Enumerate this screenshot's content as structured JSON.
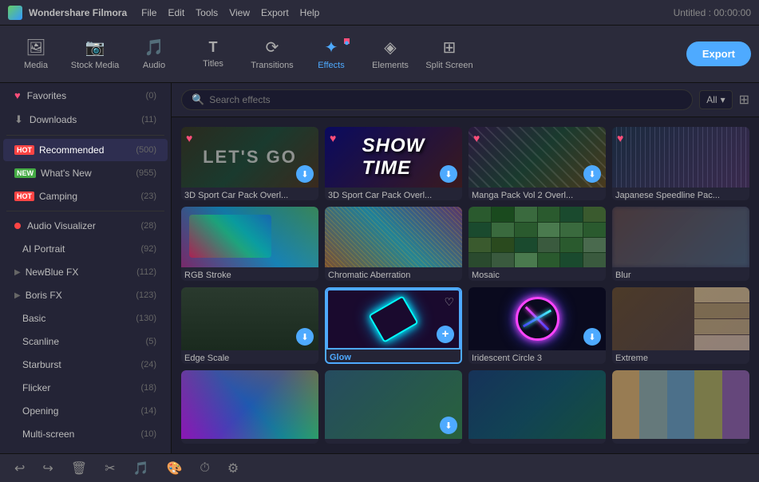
{
  "titlebar": {
    "logo": "filmora-logo",
    "appname": "Wondershare Filmora",
    "menus": [
      "File",
      "Edit",
      "Tools",
      "View",
      "Export",
      "Help"
    ],
    "title": "Untitled : 00:00:00"
  },
  "toolbar": {
    "buttons": [
      {
        "id": "media",
        "icon": "🖼",
        "label": "Media",
        "active": false
      },
      {
        "id": "stock",
        "icon": "📷",
        "label": "Stock Media",
        "active": false
      },
      {
        "id": "audio",
        "icon": "🎵",
        "label": "Audio",
        "active": false
      },
      {
        "id": "titles",
        "icon": "T",
        "label": "Titles",
        "active": false
      },
      {
        "id": "transitions",
        "icon": "⟳",
        "label": "Transitions",
        "active": false
      },
      {
        "id": "effects",
        "icon": "✦",
        "label": "Effects",
        "active": true
      },
      {
        "id": "elements",
        "icon": "◈",
        "label": "Elements",
        "active": false
      },
      {
        "id": "splitscreen",
        "icon": "⊞",
        "label": "Split Screen",
        "active": false
      }
    ],
    "export_label": "Export"
  },
  "sidebar": {
    "items": [
      {
        "id": "favorites",
        "icon": "♥",
        "label": "Favorites",
        "count": "(0)",
        "badge": null,
        "indent": false
      },
      {
        "id": "downloads",
        "icon": "⬇",
        "label": "Downloads",
        "count": "(11)",
        "badge": null,
        "indent": false
      },
      {
        "id": "recommended",
        "icon": null,
        "label": "Recommended",
        "count": "(500)",
        "badge": "HOT",
        "indent": false
      },
      {
        "id": "whatsnew",
        "icon": null,
        "label": "What's New",
        "count": "(955)",
        "badge": "NEW",
        "indent": false
      },
      {
        "id": "camping",
        "icon": null,
        "label": "Camping",
        "count": "(23)",
        "badge": "HOT",
        "indent": false
      },
      {
        "id": "audiovisualizer",
        "icon": "dot",
        "label": "Audio Visualizer",
        "count": "(28)",
        "badge": null,
        "indent": false
      },
      {
        "id": "aiportrait",
        "icon": null,
        "label": "AI Portrait",
        "count": "(92)",
        "badge": null,
        "indent": true
      },
      {
        "id": "newbluefx",
        "icon": "chevron",
        "label": "NewBlue FX",
        "count": "(112)",
        "badge": null,
        "indent": false
      },
      {
        "id": "borisfx",
        "icon": "chevron",
        "label": "Boris FX",
        "count": "(123)",
        "badge": null,
        "indent": false
      },
      {
        "id": "basic",
        "icon": null,
        "label": "Basic",
        "count": "(130)",
        "badge": null,
        "indent": true
      },
      {
        "id": "scanline",
        "icon": null,
        "label": "Scanline",
        "count": "(5)",
        "badge": null,
        "indent": true
      },
      {
        "id": "starburst",
        "icon": null,
        "label": "Starburst",
        "count": "(24)",
        "badge": null,
        "indent": true
      },
      {
        "id": "flicker",
        "icon": null,
        "label": "Flicker",
        "count": "(18)",
        "badge": null,
        "indent": true
      },
      {
        "id": "opening",
        "icon": null,
        "label": "Opening",
        "count": "(14)",
        "badge": null,
        "indent": true
      },
      {
        "id": "multiscreen",
        "icon": null,
        "label": "Multi-screen",
        "count": "(10)",
        "badge": null,
        "indent": true
      }
    ]
  },
  "search": {
    "placeholder": "Search effects",
    "filter_label": "All",
    "value": ""
  },
  "effects": [
    {
      "id": "e1",
      "label": "3D Sport Car Pack Overl...",
      "thumb_class": "thumb-1",
      "badge": "heart",
      "dl": true
    },
    {
      "id": "e2",
      "label": "3D Sport Car Pack Overl...",
      "thumb_class": "thumb-2",
      "badge": "heart",
      "dl": true
    },
    {
      "id": "e3",
      "label": "Manga Pack Vol 2 Overl...",
      "thumb_class": "thumb-3",
      "badge": "heart",
      "dl": true
    },
    {
      "id": "e4",
      "label": "Japanese Speedline Pac...",
      "thumb_class": "thumb-4",
      "badge": "heart",
      "dl": false
    },
    {
      "id": "e5",
      "label": "RGB Stroke",
      "thumb_class": "thumb-rgb",
      "badge": null,
      "dl": false
    },
    {
      "id": "e6",
      "label": "Chromatic Aberration",
      "thumb_class": "thumb-chroma",
      "badge": null,
      "dl": false
    },
    {
      "id": "e7",
      "label": "Mosaic",
      "thumb_class": "thumb-mosaic",
      "badge": null,
      "dl": false
    },
    {
      "id": "e8",
      "label": "Blur",
      "thumb_class": "thumb-blur",
      "badge": null,
      "dl": false
    },
    {
      "id": "e9",
      "label": "Edge Scale",
      "thumb_class": "thumb-edgescale",
      "badge": null,
      "dl": true
    },
    {
      "id": "e10",
      "label": "Glow",
      "thumb_class": "thumb-glow",
      "badge": null,
      "dl": false,
      "highlight": true,
      "plus": true
    },
    {
      "id": "e11",
      "label": "Iridescent Circle 3",
      "thumb_class": "thumb-iridescent",
      "badge": null,
      "dl": true
    },
    {
      "id": "e12",
      "label": "Extreme",
      "thumb_class": "thumb-extreme",
      "badge": null,
      "dl": false
    },
    {
      "id": "e13",
      "label": "",
      "thumb_class": "thumb-9",
      "badge": null,
      "dl": false
    },
    {
      "id": "e14",
      "label": "",
      "thumb_class": "thumb-10",
      "badge": null,
      "dl": true
    },
    {
      "id": "e15",
      "label": "",
      "thumb_class": "thumb-11",
      "badge": null,
      "dl": false
    },
    {
      "id": "e16",
      "label": "",
      "thumb_class": "thumb-12",
      "badge": null,
      "dl": false
    }
  ],
  "bottom_toolbar": {
    "buttons": [
      "undo",
      "redo",
      "delete",
      "cut",
      "audio",
      "color",
      "speed",
      "stabilize"
    ]
  }
}
